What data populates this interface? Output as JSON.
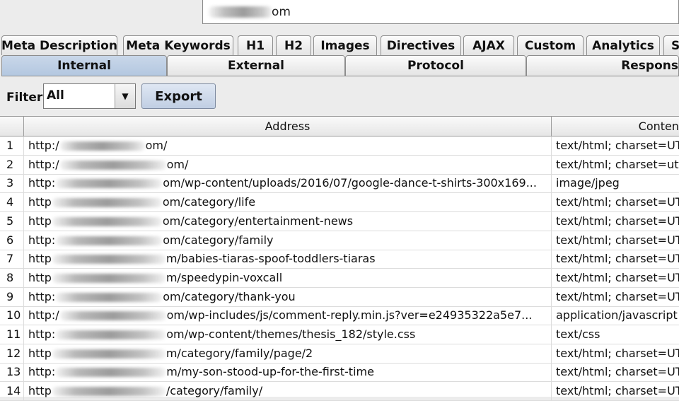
{
  "url_bar": {
    "suffix": "om"
  },
  "tabs_top": [
    "Meta Description",
    "Meta Keywords",
    "H1",
    "H2",
    "Images",
    "Directives",
    "AJAX",
    "Custom",
    "Analytics",
    "S"
  ],
  "tabs_bottom": [
    "Internal",
    "External",
    "Protocol",
    "Respons"
  ],
  "active_tab": "Internal",
  "filter": {
    "label": "Filter:",
    "value": "All",
    "export_label": "Export"
  },
  "table": {
    "columns": [
      "",
      "Address",
      "Conten"
    ],
    "rows": [
      {
        "num": "1",
        "prefix": "http:/",
        "suffix": "om/",
        "type": "text/html; charset=UT"
      },
      {
        "num": "2",
        "prefix": "http:/",
        "suffix": "om/",
        "type": "text/html; charset=utf-"
      },
      {
        "num": "3",
        "prefix": "http:",
        "suffix": "om/wp-content/uploads/2016/07/google-dance-t-shirts-300x169...",
        "type": "image/jpeg"
      },
      {
        "num": "4",
        "prefix": "http",
        "suffix": "om/category/life",
        "type": "text/html; charset=UT"
      },
      {
        "num": "5",
        "prefix": "http",
        "suffix": "om/category/entertainment-news",
        "type": "text/html; charset=UT"
      },
      {
        "num": "6",
        "prefix": "http:",
        "suffix": "om/category/family",
        "type": "text/html; charset=UT"
      },
      {
        "num": "7",
        "prefix": "http",
        "suffix": "m/babies-tiaras-spoof-toddlers-tiaras",
        "type": "text/html; charset=UT"
      },
      {
        "num": "8",
        "prefix": "http",
        "suffix": "m/speedypin-voxcall",
        "type": "text/html; charset=UT"
      },
      {
        "num": "9",
        "prefix": "http:",
        "suffix": "om/category/thank-you",
        "type": "text/html; charset=UT"
      },
      {
        "num": "10",
        "prefix": "http:/",
        "suffix": "om/wp-includes/js/comment-reply.min.js?ver=e24935322a5e7...",
        "type": "application/javascript"
      },
      {
        "num": "11",
        "prefix": "http:",
        "suffix": "om/wp-content/themes/thesis_182/style.css",
        "type": "text/css"
      },
      {
        "num": "12",
        "prefix": "http",
        "suffix": "m/category/family/page/2",
        "type": "text/html; charset=UT"
      },
      {
        "num": "13",
        "prefix": "http:",
        "suffix": "m/my-son-stood-up-for-the-first-time",
        "type": "text/html; charset=UT"
      },
      {
        "num": "14",
        "prefix": "http",
        "suffix": "/category/family/",
        "type": "text/html; charset=UT"
      }
    ]
  }
}
